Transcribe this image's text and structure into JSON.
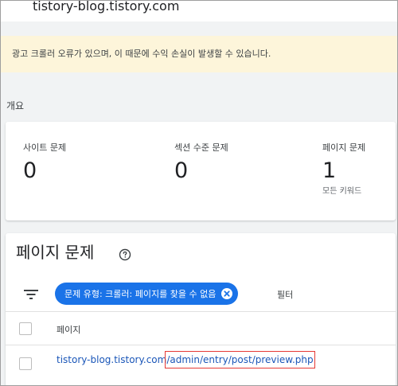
{
  "site": {
    "title": "tistory-blog.tistory.com"
  },
  "alert": {
    "message": "광고 크롤러 오류가 있으며, 이 때문에 수익 손실이 발생할 수 있습니다."
  },
  "overview": {
    "label": "개요",
    "metrics": [
      {
        "label": "사이트 문제",
        "value": "0",
        "sub": ""
      },
      {
        "label": "섹션 수준 문제",
        "value": "0",
        "sub": ""
      },
      {
        "label": "페이지 문제",
        "value": "1",
        "sub": "모든 키워드"
      }
    ]
  },
  "issues": {
    "title": "페이지 문제",
    "help_icon": "help-circle-icon",
    "filter_icon": "filter-list-icon",
    "chip_label": "문제 유형: 크롤러: 페이지를 찾을 수 없음",
    "chip_close_icon": "close-circle-icon",
    "filter_label": "필터",
    "column_header": "페이지",
    "rows": [
      {
        "url_domain": "tistory-blog.tistory.com",
        "url_path": "/admin/entry/post/preview.php"
      }
    ]
  },
  "colors": {
    "accent": "#1a73e8",
    "alert_bg": "#fdf5da",
    "link": "#1a56b8",
    "highlight_box": "#e53935"
  }
}
